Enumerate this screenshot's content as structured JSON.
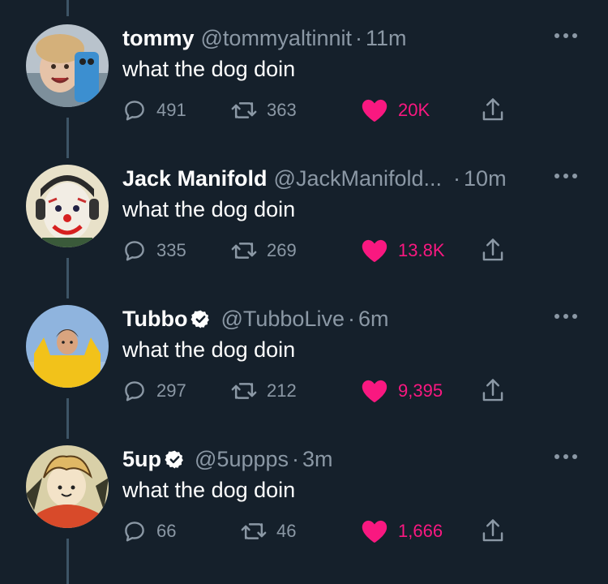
{
  "tweets": [
    {
      "name": "tommy",
      "verified": false,
      "handle": "@tommyaltinnit",
      "separator": "·",
      "time": "11m",
      "text": "what the dog doin",
      "replies": "491",
      "retweets": "363",
      "likes": "20K",
      "avatar_icon": "avatar-photo-tommy"
    },
    {
      "name": "Jack Manifold",
      "verified": false,
      "handle": "@JackManifold...",
      "separator": "·",
      "time": "10m",
      "text": "what the dog doin",
      "replies": "335",
      "retweets": "269",
      "likes": "13.8K",
      "avatar_icon": "avatar-photo-jack"
    },
    {
      "name": "Tubbo",
      "verified": true,
      "handle": "@TubboLive",
      "separator": "·",
      "time": "6m",
      "text": "what the dog doin",
      "replies": "297",
      "retweets": "212",
      "likes": "9,395",
      "avatar_icon": "avatar-photo-tubbo"
    },
    {
      "name": "5up",
      "verified": true,
      "handle": "@5uppps",
      "separator": "·",
      "time": "3m",
      "text": "what the dog doin",
      "replies": "66",
      "retweets": "46",
      "likes": "1,666",
      "avatar_icon": "avatar-drawing-5up"
    }
  ],
  "colors": {
    "background": "#15202b",
    "muted": "#8b98a5",
    "like": "#f91880",
    "thread_line": "#3d5466",
    "verified": "#ffffff"
  }
}
